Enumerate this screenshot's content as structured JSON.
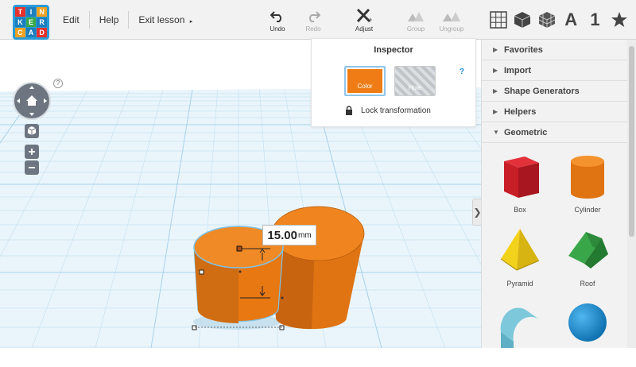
{
  "logo": {
    "letters": [
      "T",
      "I",
      "N",
      "K",
      "E",
      "R",
      "C",
      "A",
      "D"
    ]
  },
  "menu": [
    "Edit",
    "Help",
    "Exit lesson"
  ],
  "tools": [
    {
      "label": "Undo",
      "enabled": true,
      "icon": "undo-icon"
    },
    {
      "label": "Redo",
      "enabled": false,
      "icon": "redo-icon"
    },
    {
      "label": "Adjust",
      "enabled": true,
      "icon": "adjust-icon"
    },
    {
      "label": "Group",
      "enabled": false,
      "icon": "group-icon"
    },
    {
      "label": "Ungroup",
      "enabled": false,
      "icon": "ungroup-icon"
    }
  ],
  "view_icons": {
    "letter_a": "A",
    "number_1": "1"
  },
  "inspector": {
    "title": "Inspector",
    "help": "?",
    "color_label": "Color",
    "hole_label": "Hole",
    "lock_label": "Lock transformation",
    "selected_color": "#f07c16"
  },
  "measurement": {
    "value": "15.00",
    "unit": "mm"
  },
  "workplane": {
    "help": "?"
  },
  "sidebar": {
    "categories": [
      {
        "label": "Favorites",
        "expanded": false
      },
      {
        "label": "Import",
        "expanded": false
      },
      {
        "label": "Shape Generators",
        "expanded": false
      },
      {
        "label": "Helpers",
        "expanded": false
      },
      {
        "label": "Geometric",
        "expanded": true
      }
    ],
    "shapes": [
      {
        "label": "Box",
        "icon": "box-icon"
      },
      {
        "label": "Cylinder",
        "icon": "cylinder-icon"
      },
      {
        "label": "Pyramid",
        "icon": "pyramid-icon"
      },
      {
        "label": "Roof",
        "icon": "roof-icon"
      },
      {
        "label": "",
        "icon": "half-cylinder-icon"
      },
      {
        "label": "",
        "icon": "sphere-icon"
      }
    ]
  },
  "colors": {
    "accent": "#2b9bd6",
    "shape_orange": "#f07c16",
    "grid": "#c9e4f3"
  }
}
